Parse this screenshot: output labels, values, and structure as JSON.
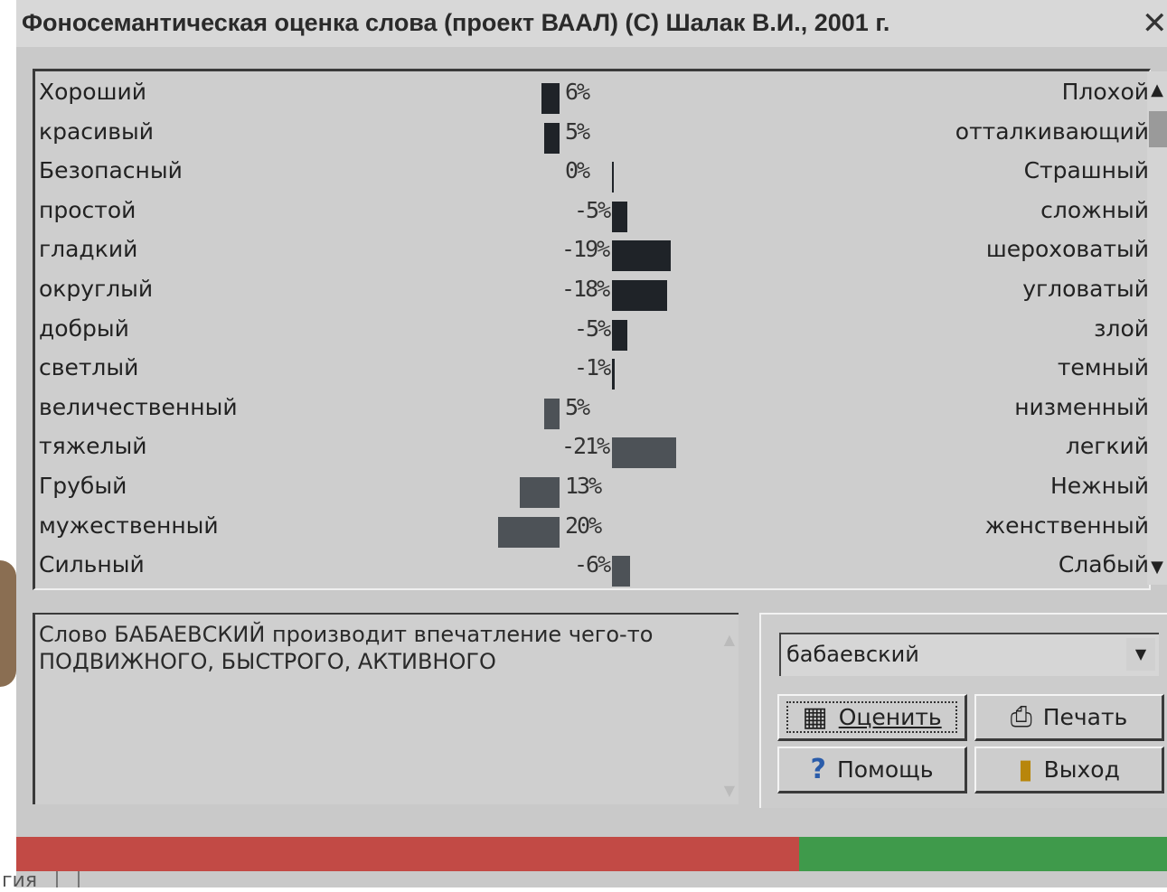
{
  "window": {
    "title": "Фоносемантическая оценка слова  (проект ВААЛ)  (С) Шалак В.И., 2001 г.",
    "close_glyph": "✕"
  },
  "scales": [
    {
      "left": "Хороший",
      "right": "Плохой",
      "percent": "6%",
      "value": 6
    },
    {
      "left": "красивый",
      "right": "отталкивающий",
      "percent": "5%",
      "value": 5
    },
    {
      "left": "Безопасный",
      "right": "Страшный",
      "percent": "0%",
      "value": 0
    },
    {
      "left": "простой",
      "right": "сложный",
      "percent": "-5%",
      "value": -5
    },
    {
      "left": "гладкий",
      "right": "шероховатый",
      "percent": "-19%",
      "value": -19
    },
    {
      "left": "округлый",
      "right": "угловатый",
      "percent": "-18%",
      "value": -18
    },
    {
      "left": "добрый",
      "right": "злой",
      "percent": "-5%",
      "value": -5
    },
    {
      "left": "светлый",
      "right": "темный",
      "percent": "-1%",
      "value": -1
    },
    {
      "left": "величественный",
      "right": "низменный",
      "percent": "5%",
      "value": 5
    },
    {
      "left": "тяжелый",
      "right": "легкий",
      "percent": "-21%",
      "value": -21
    },
    {
      "left": "Грубый",
      "right": "Нежный",
      "percent": "13%",
      "value": 13
    },
    {
      "left": "мужественный",
      "right": "женственный",
      "percent": "20%",
      "value": 20
    },
    {
      "left": "Сильный",
      "right": "Слабый",
      "percent": "-6%",
      "value": -6
    }
  ],
  "description": {
    "line1": "Слово БАБАЕВСКИЙ производит впечатление чего-то",
    "line2": "ПОДВИЖНОГО, БЫСТРОГО, АКТИВНОГО"
  },
  "controls": {
    "word_value": "бабаевский",
    "evaluate_label": "Оценить",
    "print_label": "Печать",
    "help_label": "Помощь",
    "exit_label": "Выход"
  },
  "taskbar": {
    "text": "гия"
  },
  "colors": {
    "bar_dark": "#1f2328",
    "bar_light": "#4d5257",
    "strip_red": "#c24a45",
    "strip_green": "#3f9a4b"
  }
}
